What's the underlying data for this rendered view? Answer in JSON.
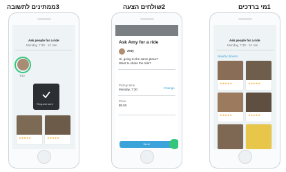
{
  "headings": {
    "step3": "3ממתינים לתשובה",
    "step2": "2שולחים הצעה",
    "step1": "1מי ברדכים"
  },
  "screen_right": {
    "title": "Ask people for a ride",
    "subtitle": "Monday, 7:30 · 12 min",
    "filter": "Nearby drivers"
  },
  "screen_middle": {
    "title": "Ask Amy for a ride",
    "name": "Amy",
    "message_line1": "Hi, going to the same place?",
    "message_line2": "Want to share the ride?",
    "pickup_label": "Pickup time",
    "pickup_value": "Monday, 7:30",
    "change_label": "Change",
    "price_label": "Price",
    "price_value": "$5.50",
    "send_label": "Send"
  },
  "screen_left": {
    "title": "Ask people for a ride",
    "subtitle": "Monday, 7:30 · 12 min",
    "you_label": "You",
    "sent_label": "Request sent"
  },
  "colors": {
    "accent": "#3aa3d9",
    "highlight": "#34c77b",
    "overlay": "#2b2f33"
  }
}
